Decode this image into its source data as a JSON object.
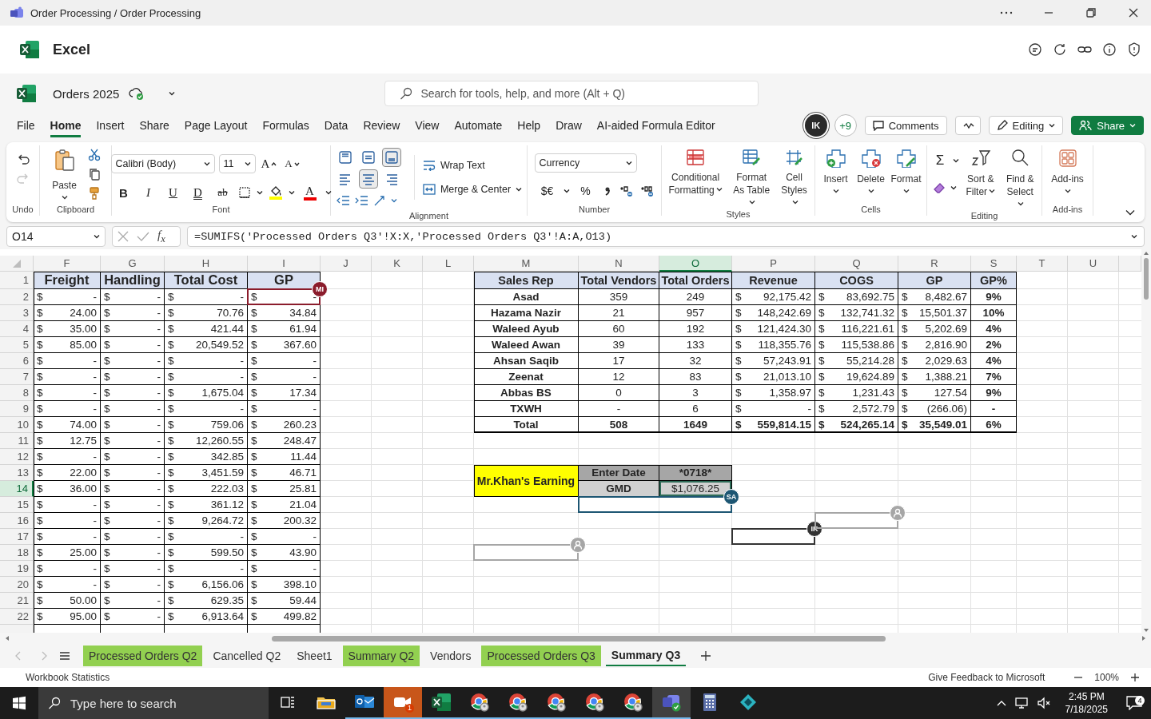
{
  "window": {
    "title": "Order Processing / Order Processing"
  },
  "app": {
    "name": "Excel"
  },
  "document": {
    "name": "Orders 2025"
  },
  "search": {
    "placeholder": "Search for tools, help, and more (Alt + Q)"
  },
  "menu": [
    {
      "label": "File",
      "selected": false
    },
    {
      "label": "Home",
      "selected": true
    },
    {
      "label": "Insert",
      "selected": false
    },
    {
      "label": "Share",
      "selected": false
    },
    {
      "label": "Page Layout",
      "selected": false
    },
    {
      "label": "Formulas",
      "selected": false
    },
    {
      "label": "Data",
      "selected": false
    },
    {
      "label": "Review",
      "selected": false
    },
    {
      "label": "View",
      "selected": false
    },
    {
      "label": "Automate",
      "selected": false
    },
    {
      "label": "Help",
      "selected": false
    },
    {
      "label": "Draw",
      "selected": false
    },
    {
      "label": "AI-aided Formula Editor",
      "selected": false
    }
  ],
  "collab": {
    "avatar": "IK",
    "others": "+9",
    "comments": "Comments",
    "mode": "Editing",
    "share": "Share"
  },
  "ribbon": {
    "undo": {
      "label": "Undo",
      "buttons": [
        {
          "kind": "undo",
          "disabled": false
        },
        {
          "kind": "redo",
          "disabled": true
        }
      ]
    },
    "clipboard": {
      "label": "Clipboard",
      "paste": "Paste"
    },
    "font": {
      "label": "Font",
      "family": "Calibri (Body)",
      "size": "11",
      "grow": "A",
      "shrink": "A",
      "font_color": "A",
      "styles": [
        {
          "kind": "bold",
          "label": "B"
        },
        {
          "kind": "italic",
          "label": "I"
        },
        {
          "kind": "underline",
          "label": "U"
        },
        {
          "kind": "double-underline",
          "label": "D"
        },
        {
          "kind": "strikethrough",
          "label": "ab"
        }
      ]
    },
    "alignment": {
      "label": "Alignment",
      "wrap": "Wrap Text",
      "merge": "Merge & Center",
      "vertical": [
        {
          "kind": "top",
          "selected": false
        },
        {
          "kind": "middle",
          "selected": false
        },
        {
          "kind": "bottom",
          "selected": true
        }
      ],
      "horizontal": [
        {
          "kind": "left",
          "selected": false
        },
        {
          "kind": "center",
          "selected": true
        },
        {
          "kind": "right",
          "selected": false
        }
      ]
    },
    "number": {
      "label": "Number",
      "format": "Currency",
      "currency": "$€",
      "percent": "%"
    },
    "styles": {
      "label": "Styles",
      "buttons": [
        "Conditional Formatting",
        "Format As Table",
        "Cell Styles"
      ]
    },
    "cells": {
      "label": "Cells",
      "buttons": [
        "Insert",
        "Delete",
        "Format"
      ]
    },
    "editing": {
      "label": "Editing",
      "sum": "Σ",
      "buttons": [
        "Sort & Filter",
        "Find & Select"
      ]
    },
    "addins": {
      "label": "Add-ins",
      "button": "Add-ins"
    }
  },
  "formula_bar": {
    "name_box": "O14",
    "function_label": "f$_{x}$",
    "formula": "=SUMIFS('Processed Orders Q3'!X:X,'Processed Orders Q3'!A:A,O13)"
  },
  "sheet": {
    "columns": [
      {
        "label": "F",
        "selected": false
      },
      {
        "label": "G",
        "selected": false
      },
      {
        "label": "H",
        "selected": false
      },
      {
        "label": "I",
        "selected": false
      },
      {
        "label": "J",
        "selected": false
      },
      {
        "label": "K",
        "selected": false
      },
      {
        "label": "L",
        "selected": false
      },
      {
        "label": "M",
        "selected": false
      },
      {
        "label": "N",
        "selected": false
      },
      {
        "label": "O",
        "selected": true
      },
      {
        "label": "P",
        "selected": false
      },
      {
        "label": "Q",
        "selected": false
      },
      {
        "label": "R",
        "selected": false
      },
      {
        "label": "S",
        "selected": false
      },
      {
        "label": "T",
        "selected": false
      },
      {
        "label": "U",
        "selected": false
      }
    ],
    "rows": [
      {
        "label": "1",
        "selected": false
      },
      {
        "label": "2",
        "selected": false
      },
      {
        "label": "3",
        "selected": false
      },
      {
        "label": "4",
        "selected": false
      },
      {
        "label": "5",
        "selected": false
      },
      {
        "label": "6",
        "selected": false
      },
      {
        "label": "7",
        "selected": false
      },
      {
        "label": "8",
        "selected": false
      },
      {
        "label": "9",
        "selected": false
      },
      {
        "label": "10",
        "selected": false
      },
      {
        "label": "11",
        "selected": false
      },
      {
        "label": "12",
        "selected": false
      },
      {
        "label": "13",
        "selected": false
      },
      {
        "label": "14",
        "selected": true
      },
      {
        "label": "15",
        "selected": false
      },
      {
        "label": "16",
        "selected": false
      },
      {
        "label": "17",
        "selected": false
      },
      {
        "label": "18",
        "selected": false
      },
      {
        "label": "19",
        "selected": false
      },
      {
        "label": "20",
        "selected": false
      },
      {
        "label": "21",
        "selected": false
      },
      {
        "label": "22",
        "selected": false
      }
    ]
  },
  "cost_table": {
    "headers": [
      "Freight",
      "Handling",
      "Total Cost",
      "GP"
    ],
    "rows": [
      [
        [
          "$",
          "-"
        ],
        [
          "$",
          "-"
        ],
        [
          "$",
          "-"
        ],
        [
          "$",
          "-"
        ]
      ],
      [
        [
          "$",
          "24.00"
        ],
        [
          "$",
          "-"
        ],
        [
          "$",
          "70.76"
        ],
        [
          "$",
          "34.84"
        ]
      ],
      [
        [
          "$",
          "35.00"
        ],
        [
          "$",
          "-"
        ],
        [
          "$",
          "421.44"
        ],
        [
          "$",
          "61.94"
        ]
      ],
      [
        [
          "$",
          "85.00"
        ],
        [
          "$",
          "-"
        ],
        [
          "$",
          "20,549.52"
        ],
        [
          "$",
          "367.60"
        ]
      ],
      [
        [
          "$",
          "-"
        ],
        [
          "$",
          "-"
        ],
        [
          "$",
          "-"
        ],
        [
          "$",
          "-"
        ]
      ],
      [
        [
          "$",
          "-"
        ],
        [
          "$",
          "-"
        ],
        [
          "$",
          "-"
        ],
        [
          "$",
          "-"
        ]
      ],
      [
        [
          "$",
          "-"
        ],
        [
          "$",
          "-"
        ],
        [
          "$",
          "1,675.04"
        ],
        [
          "$",
          "17.34"
        ]
      ],
      [
        [
          "$",
          "-"
        ],
        [
          "$",
          "-"
        ],
        [
          "$",
          "-"
        ],
        [
          "$",
          "-"
        ]
      ],
      [
        [
          "$",
          "74.00"
        ],
        [
          "$",
          "-"
        ],
        [
          "$",
          "759.06"
        ],
        [
          "$",
          "260.23"
        ]
      ],
      [
        [
          "$",
          "12.75"
        ],
        [
          "$",
          "-"
        ],
        [
          "$",
          "12,260.55"
        ],
        [
          "$",
          "248.47"
        ]
      ],
      [
        [
          "$",
          "-"
        ],
        [
          "$",
          "-"
        ],
        [
          "$",
          "342.85"
        ],
        [
          "$",
          "11.44"
        ]
      ],
      [
        [
          "$",
          "22.00"
        ],
        [
          "$",
          "-"
        ],
        [
          "$",
          "3,451.59"
        ],
        [
          "$",
          "46.71"
        ]
      ],
      [
        [
          "$",
          "36.00"
        ],
        [
          "$",
          "-"
        ],
        [
          "$",
          "222.03"
        ],
        [
          "$",
          "25.81"
        ]
      ],
      [
        [
          "$",
          "-"
        ],
        [
          "$",
          "-"
        ],
        [
          "$",
          "361.12"
        ],
        [
          "$",
          "21.04"
        ]
      ],
      [
        [
          "$",
          "-"
        ],
        [
          "$",
          "-"
        ],
        [
          "$",
          "9,264.72"
        ],
        [
          "$",
          "200.32"
        ]
      ],
      [
        [
          "$",
          "-"
        ],
        [
          "$",
          "-"
        ],
        [
          "$",
          "-"
        ],
        [
          "$",
          "-"
        ]
      ],
      [
        [
          "$",
          "25.00"
        ],
        [
          "$",
          "-"
        ],
        [
          "$",
          "599.50"
        ],
        [
          "$",
          "43.90"
        ]
      ],
      [
        [
          "$",
          "-"
        ],
        [
          "$",
          "-"
        ],
        [
          "$",
          "-"
        ],
        [
          "$",
          "-"
        ]
      ],
      [
        [
          "$",
          "-"
        ],
        [
          "$",
          "-"
        ],
        [
          "$",
          "6,156.06"
        ],
        [
          "$",
          "398.10"
        ]
      ],
      [
        [
          "$",
          "50.00"
        ],
        [
          "$",
          "-"
        ],
        [
          "$",
          "629.35"
        ],
        [
          "$",
          "59.44"
        ]
      ],
      [
        [
          "$",
          "95.00"
        ],
        [
          "$",
          "-"
        ],
        [
          "$",
          "6,913.64"
        ],
        [
          "$",
          "499.82"
        ]
      ]
    ]
  },
  "sales_table": {
    "headers": [
      "Sales Rep",
      "Total Vendors",
      "Total Orders",
      "Revenue",
      "COGS",
      "GP",
      "GP%"
    ],
    "rows": [
      {
        "rep": "Asad",
        "vendors": "359",
        "orders": "249",
        "revenue": [
          "$",
          "92,175.42"
        ],
        "cogs": [
          "$",
          "83,692.75"
        ],
        "gp": [
          "$",
          "8,482.67"
        ],
        "gp_pct": "9%"
      },
      {
        "rep": "Hazama Nazir",
        "vendors": "21",
        "orders": "957",
        "revenue": [
          "$",
          "148,242.69"
        ],
        "cogs": [
          "$",
          "132,741.32"
        ],
        "gp": [
          "$",
          "15,501.37"
        ],
        "gp_pct": "10%"
      },
      {
        "rep": "Waleed Ayub",
        "vendors": "60",
        "orders": "192",
        "revenue": [
          "$",
          "121,424.30"
        ],
        "cogs": [
          "$",
          "116,221.61"
        ],
        "gp": [
          "$",
          "5,202.69"
        ],
        "gp_pct": "4%"
      },
      {
        "rep": "Waleed Awan",
        "vendors": "39",
        "orders": "133",
        "revenue": [
          "$",
          "118,355.76"
        ],
        "cogs": [
          "$",
          "115,538.86"
        ],
        "gp": [
          "$",
          "2,816.90"
        ],
        "gp_pct": "2%"
      },
      {
        "rep": "Ahsan Saqib",
        "vendors": "17",
        "orders": "32",
        "revenue": [
          "$",
          "57,243.91"
        ],
        "cogs": [
          "$",
          "55,214.28"
        ],
        "gp": [
          "$",
          "2,029.63"
        ],
        "gp_pct": "4%"
      },
      {
        "rep": "Zeenat",
        "vendors": "12",
        "orders": "83",
        "revenue": [
          "$",
          "21,013.10"
        ],
        "cogs": [
          "$",
          "19,624.89"
        ],
        "gp": [
          "$",
          "1,388.21"
        ],
        "gp_pct": "7%"
      },
      {
        "rep": "Abbas BS",
        "vendors": "0",
        "orders": "3",
        "revenue": [
          "$",
          "1,358.97"
        ],
        "cogs": [
          "$",
          "1,231.43"
        ],
        "gp": [
          "$",
          "127.54"
        ],
        "gp_pct": "9%"
      },
      {
        "rep": "TXWH",
        "vendors": "-",
        "orders": "6",
        "revenue": [
          "$",
          "-"
        ],
        "cogs": [
          "$",
          "2,572.79"
        ],
        "gp": [
          "$",
          "(266.06)"
        ],
        "gp_pct": "-"
      }
    ],
    "total": {
      "rep": "Total",
      "vendors": "508",
      "orders": "1649",
      "revenue": [
        "$",
        "559,814.15"
      ],
      "cogs": [
        "$",
        "524,265.14"
      ],
      "gp": [
        "$",
        "35,549.01"
      ],
      "gp_pct": "6%"
    }
  },
  "earning": {
    "title": "Mr.Khan's Earning",
    "rows": [
      {
        "label": "Enter Date",
        "value": "*0718*"
      },
      {
        "label": "GMD",
        "value": "$1,076.25"
      }
    ]
  },
  "presence": [
    {
      "kind": "initials",
      "initials": "MI",
      "color": "#8b1c2c"
    },
    {
      "kind": "initials",
      "initials": "SA",
      "color": "#1d5673"
    },
    {
      "kind": "initials",
      "initials": "IK",
      "color": "#333333"
    },
    {
      "kind": "guest",
      "color": "#a6a6a6"
    },
    {
      "kind": "guest",
      "color": "#a6a6a6"
    }
  ],
  "sheet_tabs": [
    {
      "label": "Processed Orders Q2",
      "selected": false,
      "color": "#92d050"
    },
    {
      "label": "Cancelled Q2",
      "selected": false
    },
    {
      "label": "Sheet1",
      "selected": false
    },
    {
      "label": "Summary Q2",
      "selected": false,
      "color": "#92d050"
    },
    {
      "label": "Vendors",
      "selected": false
    },
    {
      "label": "Processed Orders Q3",
      "selected": false,
      "color": "#92d050"
    },
    {
      "label": "Summary Q3",
      "selected": true
    }
  ],
  "status_bar": {
    "left": "Workbook Statistics",
    "feedback": "Give Feedback to Microsoft",
    "zoom": "100%"
  },
  "taskbar": {
    "search_placeholder": "Type here to search",
    "apps": [
      {
        "kind": "task-view",
        "running": false,
        "selected": false,
        "flashing": false
      },
      {
        "kind": "folder",
        "running": false,
        "selected": false,
        "flashing": false
      },
      {
        "kind": "mail",
        "running": true,
        "selected": false,
        "flashing": false
      },
      {
        "kind": "video",
        "running": true,
        "selected": false,
        "flashing": true,
        "badge": "1"
      },
      {
        "kind": "sheet",
        "running": true,
        "selected": false,
        "flashing": false
      },
      {
        "kind": "browser",
        "running": true,
        "selected": false,
        "flashing": false
      },
      {
        "kind": "browser",
        "running": true,
        "selected": false,
        "flashing": false
      },
      {
        "kind": "browser",
        "running": true,
        "selected": false,
        "flashing": false
      },
      {
        "kind": "browser",
        "running": true,
        "selected": false,
        "flashing": false
      },
      {
        "kind": "browser",
        "running": true,
        "selected": false,
        "flashing": false
      },
      {
        "kind": "team",
        "running": true,
        "selected": true,
        "flashing": false
      },
      {
        "kind": "calculator",
        "running": false,
        "selected": false,
        "flashing": false
      },
      {
        "kind": "diamond",
        "running": false,
        "selected": false,
        "flashing": false
      }
    ],
    "time": "2:45 PM",
    "date": "7/18/2025",
    "notifications": "4"
  }
}
